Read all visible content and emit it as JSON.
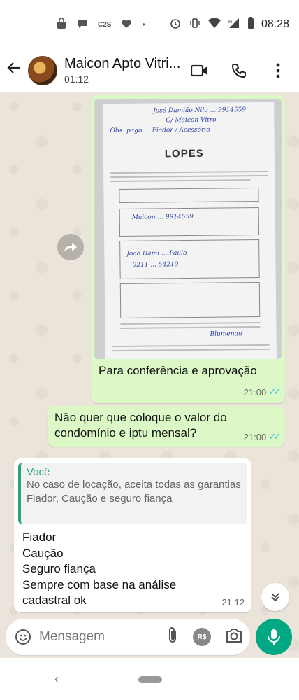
{
  "status_bar": {
    "left_icons": [
      "bag-icon",
      "chat-icon",
      "c2s-label",
      "heart-icon",
      "dot-icon"
    ],
    "c2s_text": "C2S",
    "time": "08:28"
  },
  "header": {
    "contact_name": "Maicon Apto Vitri...",
    "subtitle": "01:12"
  },
  "messages": {
    "image_msg": {
      "caption": "Para conferência e aprovação",
      "time": "21:00",
      "doc_brand": "LOPES"
    },
    "msg2": {
      "text": "Não quer que coloque o valor do condomínio e iptu mensal?",
      "time": "21:00"
    },
    "msg3": {
      "quoted_author": "Você",
      "quoted_text_1": "No caso de locação, aceita todas as garantias",
      "quoted_text_2": "Fiador, Caução e seguro fiança",
      "line_1": "Fiador",
      "line_2": "Caução",
      "line_3": "Seguro fiança",
      "line_4": "Sempre com base na análise cadastral ok",
      "time": "21:12"
    }
  },
  "input": {
    "placeholder": "Mensagem",
    "rs_label": "R$"
  },
  "colors": {
    "outgoing": "#DCF8C6",
    "accent": "#00A884",
    "read_ticks": "#34B7F1"
  }
}
